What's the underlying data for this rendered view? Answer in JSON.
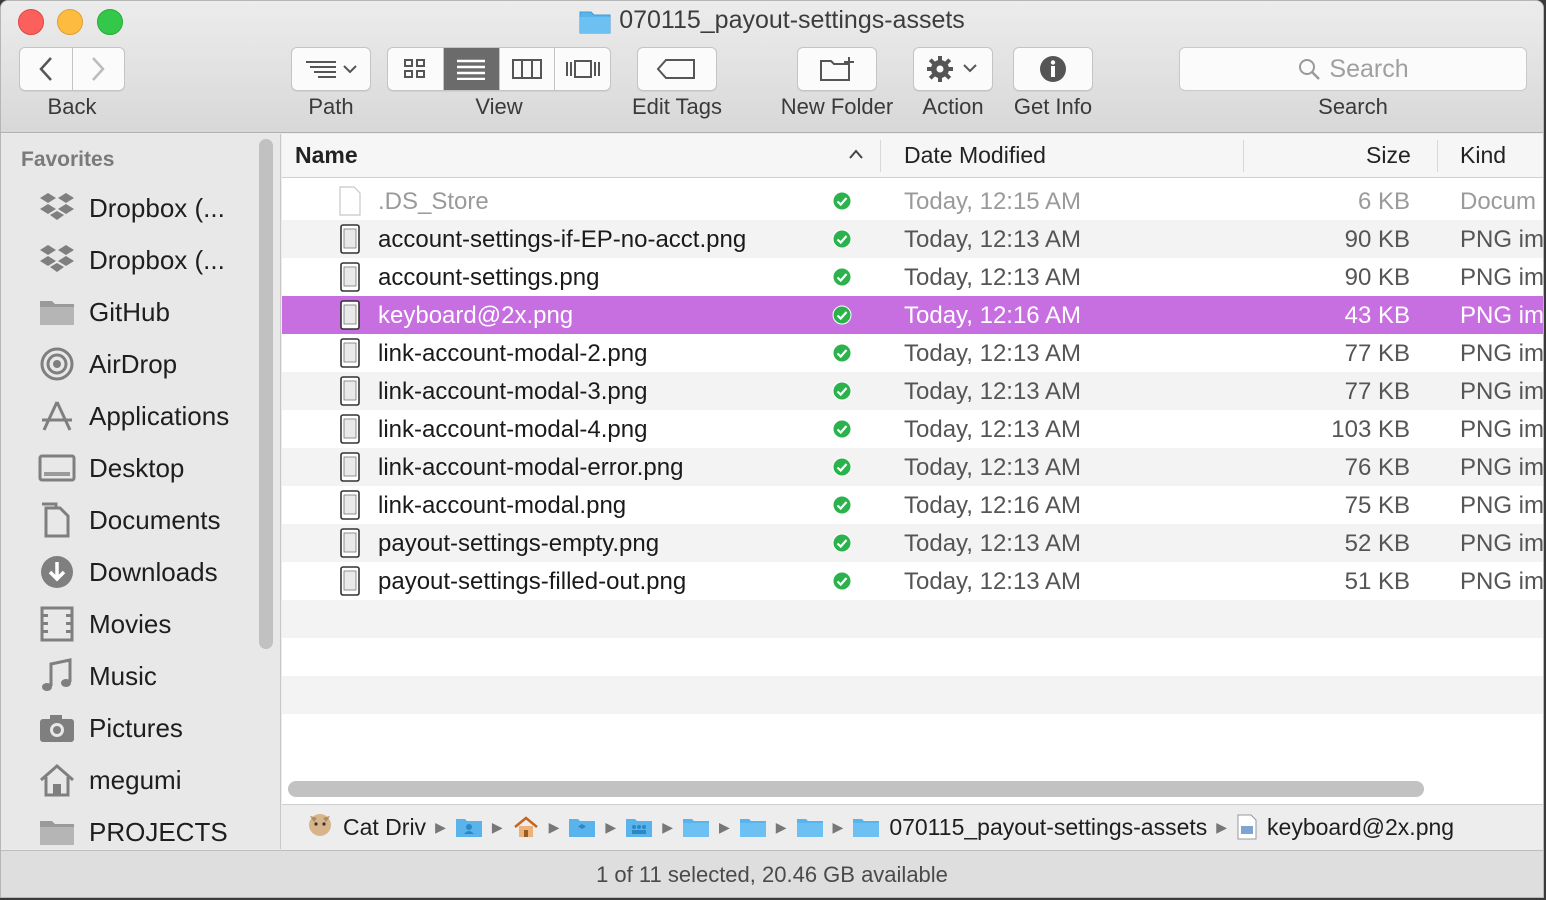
{
  "window": {
    "title": "070115_payout-settings-assets"
  },
  "toolbar": {
    "back_label": "Back",
    "path_label": "Path",
    "view_label": "View",
    "edit_tags_label": "Edit Tags",
    "new_folder_label": "New Folder",
    "action_label": "Action",
    "get_info_label": "Get Info",
    "search_label": "Search",
    "search_placeholder": "Search"
  },
  "sidebar": {
    "header": "Favorites",
    "items": [
      {
        "label": "Dropbox (...",
        "icon": "dropbox-icon"
      },
      {
        "label": "Dropbox (...",
        "icon": "dropbox-icon"
      },
      {
        "label": "GitHub",
        "icon": "folder-icon"
      },
      {
        "label": "AirDrop",
        "icon": "airdrop-icon"
      },
      {
        "label": "Applications",
        "icon": "applications-icon"
      },
      {
        "label": "Desktop",
        "icon": "desktop-icon"
      },
      {
        "label": "Documents",
        "icon": "documents-icon"
      },
      {
        "label": "Downloads",
        "icon": "downloads-icon"
      },
      {
        "label": "Movies",
        "icon": "movies-icon"
      },
      {
        "label": "Music",
        "icon": "music-icon"
      },
      {
        "label": "Pictures",
        "icon": "pictures-icon"
      },
      {
        "label": "megumi",
        "icon": "home-icon"
      },
      {
        "label": "PROJECTS",
        "icon": "folder-icon"
      }
    ]
  },
  "columns": {
    "name": "Name",
    "date": "Date Modified",
    "size": "Size",
    "kind": "Kind"
  },
  "files": [
    {
      "name": ".DS_Store",
      "date": "Today, 12:15 AM",
      "size": "6 KB",
      "kind": "Docum"
    },
    {
      "name": "account-settings-if-EP-no-acct.png",
      "date": "Today, 12:13 AM",
      "size": "90 KB",
      "kind": "PNG im"
    },
    {
      "name": "account-settings.png",
      "date": "Today, 12:13 AM",
      "size": "90 KB",
      "kind": "PNG im"
    },
    {
      "name": "keyboard@2x.png",
      "date": "Today, 12:16 AM",
      "size": "43 KB",
      "kind": "PNG im"
    },
    {
      "name": "link-account-modal-2.png",
      "date": "Today, 12:13 AM",
      "size": "77 KB",
      "kind": "PNG im"
    },
    {
      "name": "link-account-modal-3.png",
      "date": "Today, 12:13 AM",
      "size": "77 KB",
      "kind": "PNG im"
    },
    {
      "name": "link-account-modal-4.png",
      "date": "Today, 12:13 AM",
      "size": "103 KB",
      "kind": "PNG im"
    },
    {
      "name": "link-account-modal-error.png",
      "date": "Today, 12:13 AM",
      "size": "76 KB",
      "kind": "PNG im"
    },
    {
      "name": "link-account-modal.png",
      "date": "Today, 12:16 AM",
      "size": "75 KB",
      "kind": "PNG im"
    },
    {
      "name": "payout-settings-empty.png",
      "date": "Today, 12:13 AM",
      "size": "52 KB",
      "kind": "PNG im"
    },
    {
      "name": "payout-settings-filled-out.png",
      "date": "Today, 12:13 AM",
      "size": "51 KB",
      "kind": "PNG im"
    }
  ],
  "pathbar": {
    "root": "Cat Driv",
    "folder": "070115_payout-settings-assets",
    "file": "keyboard@2x.png"
  },
  "status": {
    "text": "1 of 11 selected, 20.46 GB available"
  },
  "colors": {
    "selection": "#c76fe0",
    "sync_check": "#2bb24c",
    "folder_blue": "#5ab4ec"
  }
}
